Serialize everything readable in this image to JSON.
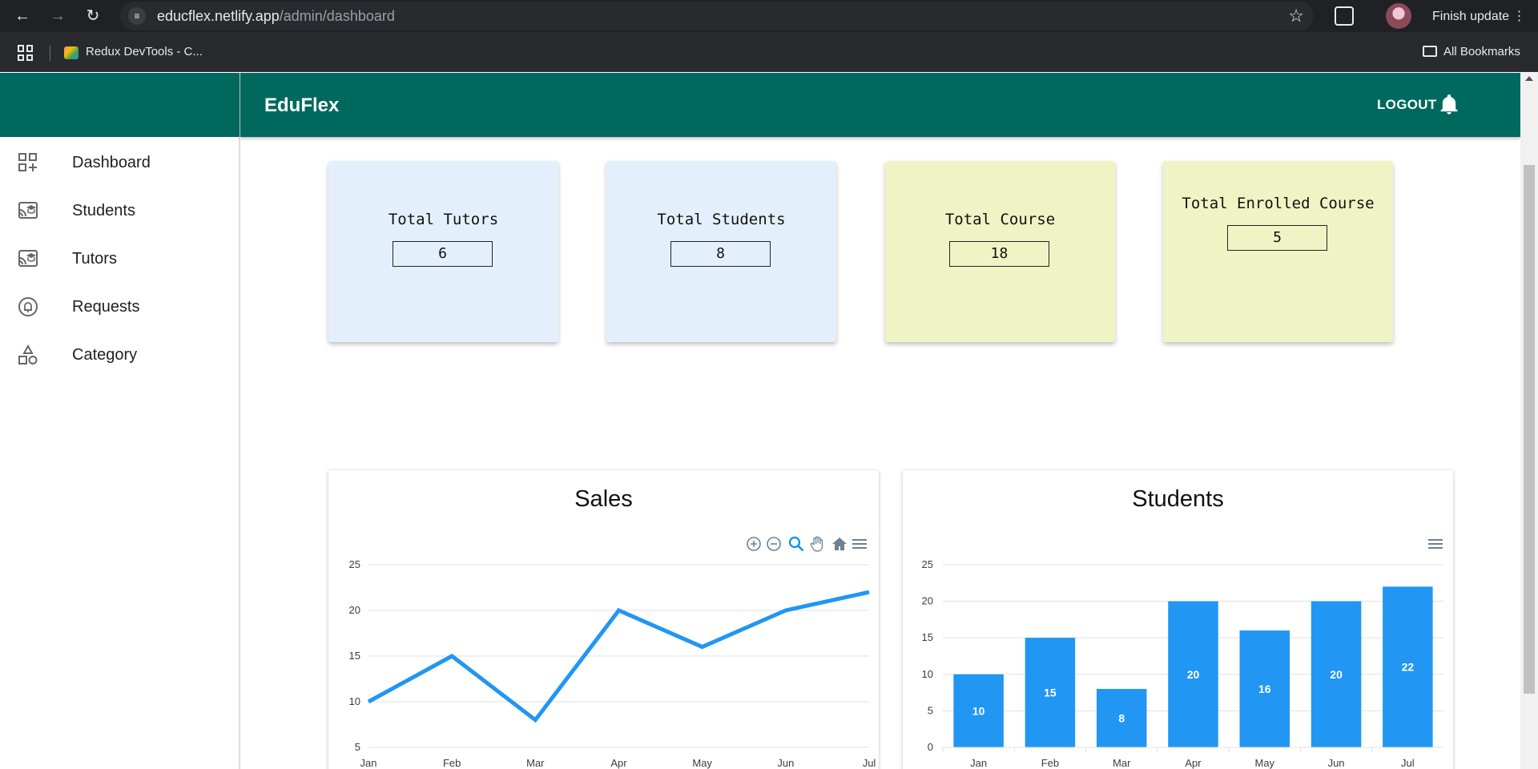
{
  "browser": {
    "url_host": "educflex.netlify.app",
    "url_path": "/admin/dashboard",
    "finish_update_label": "Finish update",
    "bookmark_label": "Redux DevTools - C...",
    "all_bookmarks_label": "All Bookmarks"
  },
  "app": {
    "brand": "EduFlex",
    "logout_label": "LOGOUT"
  },
  "sidebar": {
    "items": [
      {
        "label": "Dashboard",
        "icon": "dashboard-add-icon"
      },
      {
        "label": "Students",
        "icon": "cast-for-education-icon"
      },
      {
        "label": "Tutors",
        "icon": "cast-for-education-icon"
      },
      {
        "label": "Requests",
        "icon": "notification-bell-circle-icon"
      },
      {
        "label": "Category",
        "icon": "category-shapes-icon"
      }
    ]
  },
  "stats": [
    {
      "title": "Total Tutors",
      "value": "6",
      "color": "#e3f0fc"
    },
    {
      "title": "Total Students",
      "value": "8",
      "color": "#e3f0fc"
    },
    {
      "title": "Total Course",
      "value": "18",
      "color": "#f0f4c4"
    },
    {
      "title": "Total Enrolled Course",
      "value": "5",
      "color": "#f0f4c4"
    }
  ],
  "chart_data": [
    {
      "type": "line",
      "title": "Sales",
      "categories": [
        "Jan",
        "Feb",
        "Mar",
        "Apr",
        "May",
        "Jun",
        "Jul"
      ],
      "series": [
        {
          "values": [
            10,
            15,
            8,
            20,
            16,
            20,
            22
          ]
        }
      ],
      "yticks": [
        5,
        10,
        15,
        20,
        25
      ],
      "ylim": [
        5,
        25
      ],
      "grid": true,
      "color": "#2196f3"
    },
    {
      "type": "bar",
      "title": "Students",
      "categories": [
        "Jan",
        "Feb",
        "Mar",
        "Apr",
        "May",
        "Jun",
        "Jul"
      ],
      "series": [
        {
          "values": [
            10,
            15,
            8,
            20,
            16,
            20,
            22
          ]
        }
      ],
      "yticks": [
        0,
        5,
        10,
        15,
        20,
        25
      ],
      "ylim": [
        0,
        25
      ],
      "grid": true,
      "data_labels": true,
      "color": "#2196f3"
    }
  ]
}
